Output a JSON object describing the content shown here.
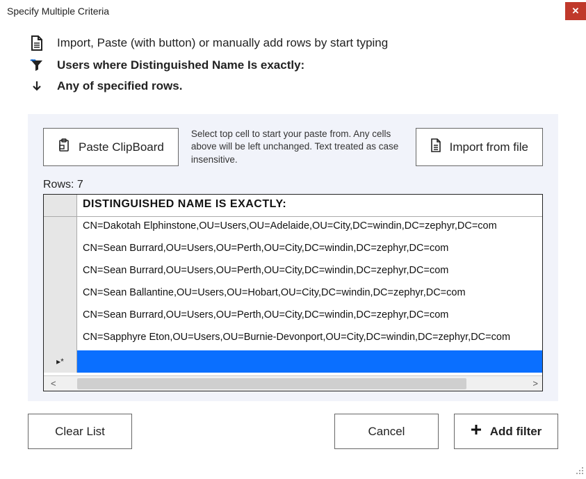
{
  "window": {
    "title": "Specify Multiple Criteria"
  },
  "header": {
    "line1": "Import, Paste (with button) or manually add rows by start typing",
    "line2": "Users where Distinguished Name Is exactly:",
    "line3": "Any of specified rows."
  },
  "toolbar": {
    "paste_label": "Paste ClipBoard",
    "hint": "Select top cell to start your paste from. Any cells above will be left unchanged. Text treated as case insensitive.",
    "import_label": "Import from file"
  },
  "grid": {
    "row_count_label": "Rows: 7",
    "column_header": "DISTINGUISHED NAME IS EXACTLY:",
    "rows": [
      "CN=Dakotah Elphinstone,OU=Users,OU=Adelaide,OU=City,DC=windin,DC=zephyr,DC=com",
      "CN=Sean Burrard,OU=Users,OU=Perth,OU=City,DC=windin,DC=zephyr,DC=com",
      "CN=Sean Burrard,OU=Users,OU=Perth,OU=City,DC=windin,DC=zephyr,DC=com",
      "CN=Sean Ballantine,OU=Users,OU=Hobart,OU=City,DC=windin,DC=zephyr,DC=com",
      "CN=Sean Burrard,OU=Users,OU=Perth,OU=City,DC=windin,DC=zephyr,DC=com",
      "CN=Sapphyre Eton,OU=Users,OU=Burnie-Devonport,OU=City,DC=windin,DC=zephyr,DC=com"
    ],
    "new_row_marker": "▸*"
  },
  "scroll": {
    "left": "<",
    "right": ">"
  },
  "footer": {
    "clear_label": "Clear List",
    "cancel_label": "Cancel",
    "add_label": "Add filter"
  }
}
